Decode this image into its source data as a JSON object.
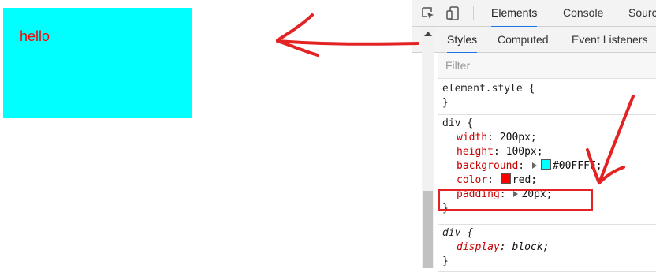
{
  "page": {
    "box_text": "hello",
    "box_background": "#00FFFF",
    "box_text_color": "red"
  },
  "devtools": {
    "tabs": [
      "Elements",
      "Console",
      "Sourc"
    ],
    "active_tab": "Elements",
    "subtabs": [
      "Styles",
      "Computed",
      "Event Listeners"
    ],
    "active_subtab": "Styles",
    "filter_placeholder": "Filter",
    "rules": {
      "element_style": {
        "selector": "element.style {",
        "close": "}"
      },
      "div_rule": {
        "selector": "div {",
        "width_prop": "width",
        "width_val": "200px;",
        "height_prop": "height",
        "height_val": "100px;",
        "background_prop": "background",
        "background_val": "#00FFFF;",
        "color_prop": "color",
        "color_val": "red;",
        "padding_prop": "padding",
        "padding_val": "20px;",
        "close": "}"
      },
      "ua_rule": {
        "selector": "div {",
        "display_prop": "display",
        "display_val": "block;",
        "close": "}"
      }
    },
    "colors": {
      "accent": "#1a73e8",
      "annotation": "#e32323",
      "swatch_cyan": "#00FFFF",
      "swatch_red": "#ff0000"
    },
    "icons": [
      "inspect-element-icon",
      "device-toolbar-icon",
      "scroll-up-icon"
    ]
  }
}
